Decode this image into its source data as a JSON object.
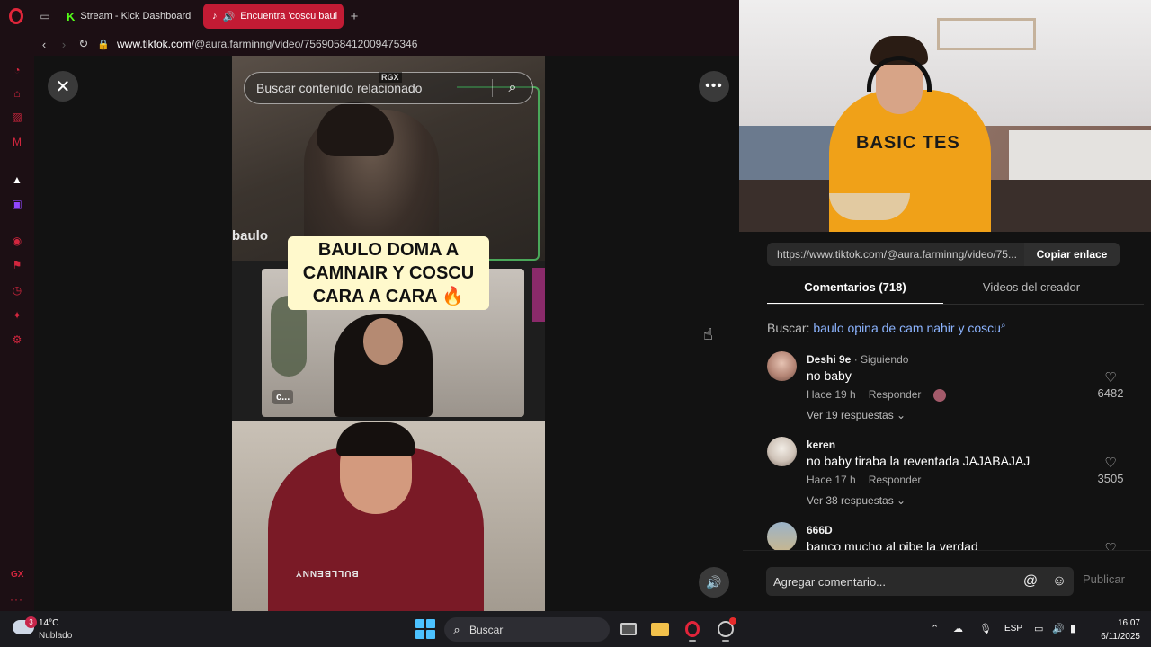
{
  "browser": {
    "tabs": [
      {
        "label": "Stream - Kick Dashboard",
        "icon": "kick-icon",
        "active": false
      },
      {
        "label": "Encuentra 'coscu baul",
        "icon": "tiktok-icon",
        "active": true,
        "audio": true
      }
    ],
    "new_tab": "+",
    "url_host": "www.tiktok.com",
    "url_path": "/@aura.farminng/video/7569058412009475346"
  },
  "sidebar": {
    "gx_label": "GX",
    "more": "···"
  },
  "viewer": {
    "search_placeholder": "Buscar contenido relacionado",
    "watermark": "RGX",
    "caption": "BAULO DOMA A CAMNAIR Y COSCU CARA A CARA 🔥",
    "overlay_label_top": "baulo",
    "overlay_label_mid": "c...",
    "shirt_text": "BULLBENNY"
  },
  "webcam": {
    "shirt_text": "BASIC TES"
  },
  "panel": {
    "share_link": "https://www.tiktok.com/@aura.farminng/video/75...",
    "copy_label": "Copiar enlace",
    "tabs": [
      {
        "label": "Comentarios (718)",
        "active": true
      },
      {
        "label": "Videos del creador",
        "active": false
      }
    ],
    "search_prefix": "Buscar:",
    "search_query": "baulo opina de cam nahir y coscu",
    "comments": [
      {
        "user": "Deshi 9e",
        "status": "· Siguiendo",
        "text": "no baby",
        "time": "Hace 19 h",
        "reply": "Responder",
        "replies": "Ver 19 respuestas ⌄",
        "likes": "6482"
      },
      {
        "user": "keren",
        "status": "",
        "text": "no baby tiraba la reventada JAJABAJAJ",
        "time": "Hace 17 h",
        "reply": "Responder",
        "replies": "Ver 38 respuestas ⌄",
        "likes": "3505"
      },
      {
        "user": "666D",
        "status": "",
        "text": "banco mucho al pibe la verdad",
        "time": "",
        "reply": "",
        "replies": "",
        "likes": ""
      }
    ],
    "compose_placeholder": "Agregar comentario...",
    "publish_label": "Publicar"
  },
  "taskbar": {
    "weather_badge": "3",
    "weather_temp": "14°C",
    "weather_desc": "Nublado",
    "search_placeholder": "Buscar",
    "language": "ESP",
    "time": "16:07",
    "date": "6/11/2025"
  },
  "colors": {
    "accent_red": "#c21b34",
    "kick_green": "#53fc18",
    "link_blue": "#8cb4ff"
  }
}
